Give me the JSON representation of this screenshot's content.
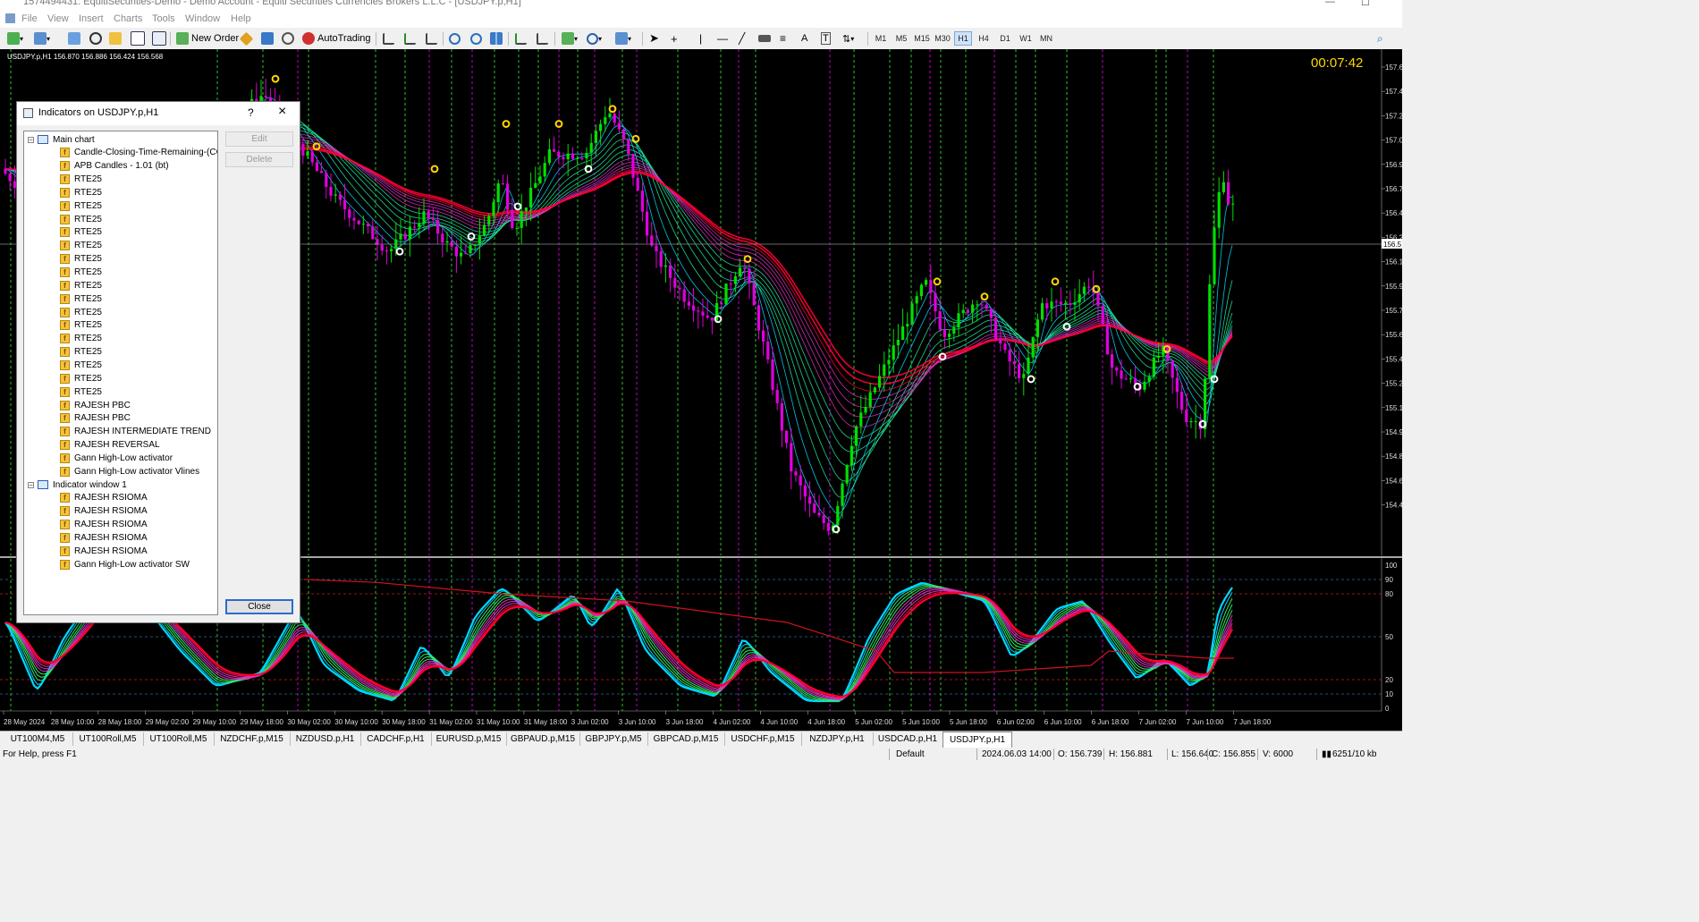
{
  "window": {
    "title": "1574494431: EquitiSecurities-Demo - Demo Account - Equiti Securities Currencies Brokers L.L.C - [USDJPY.p,H1]"
  },
  "menu": [
    "File",
    "View",
    "Insert",
    "Charts",
    "Tools",
    "Window",
    "Help"
  ],
  "toolbar": {
    "new_order": "New Order",
    "autotrading": "AutoTrading",
    "timeframes": [
      "M1",
      "M5",
      "M15",
      "M30",
      "H1",
      "H4",
      "D1",
      "W1",
      "MN"
    ],
    "active_timeframe": "H1"
  },
  "chart": {
    "symbol_info": "USDJPY.p,H1  156.870 156.886 156.424 156.568",
    "timer": "00:07:42",
    "current_price": "156.5",
    "price_labels": [
      "157.6",
      "157.4",
      "157.2",
      "157.0",
      "156.9",
      "156.7",
      "156.4",
      "156.2",
      "156.1",
      "155.9",
      "155.7",
      "155.6",
      "155.4",
      "155.2",
      "155.1",
      "154.9",
      "154.8",
      "154.6",
      "154.4"
    ],
    "osc_labels": [
      "100",
      "90",
      "80",
      "50",
      "20",
      "10",
      "0"
    ],
    "time_labels": [
      "28 May 2024",
      "28 May 10:00",
      "28 May 18:00",
      "29 May 02:00",
      "29 May 10:00",
      "29 May 18:00",
      "30 May 02:00",
      "30 May 10:00",
      "30 May 18:00",
      "31 May 02:00",
      "31 May 10:00",
      "31 May 18:00",
      "3 Jun 02:00",
      "3 Jun 10:00",
      "3 Jun 18:00",
      "4 Jun 02:00",
      "4 Jun 10:00",
      "4 Jun 18:00",
      "5 Jun 02:00",
      "5 Jun 10:00",
      "5 Jun 18:00",
      "6 Jun 02:00",
      "6 Jun 10:00",
      "6 Jun 18:00",
      "7 Jun 02:00",
      "7 Jun 10:00",
      "7 Jun 18:00"
    ],
    "colors": {
      "bg": "#000000",
      "bull": "#00e000",
      "bear": "#e000e0",
      "fast_band": "#00d8ff",
      "slow_band": "#ff0033",
      "vline_green": "#2ec02e",
      "vline_magenta": "#c000c0",
      "timer": "#ffd700"
    }
  },
  "dialog": {
    "title": "Indicators on USDJPY.p,H1",
    "help": "?",
    "groups": [
      {
        "label": "Main chart",
        "items": [
          "Candle-Closing-Time-Remaining-(CCTR)",
          "APB Candles - 1.01 (bt)",
          "RTE25",
          "RTE25",
          "RTE25",
          "RTE25",
          "RTE25",
          "RTE25",
          "RTE25",
          "RTE25",
          "RTE25",
          "RTE25",
          "RTE25",
          "RTE25",
          "RTE25",
          "RTE25",
          "RTE25",
          "RTE25",
          "RTE25",
          "RAJESH PBC",
          "RAJESH PBC",
          "RAJESH INTERMEDIATE TREND",
          "RAJESH REVERSAL",
          "Gann High-Low activator",
          "Gann High-Low activator Vlines"
        ]
      },
      {
        "label": "Indicator window 1",
        "items": [
          "RAJESH RSIOMA",
          "RAJESH RSIOMA",
          "RAJESH RSIOMA",
          "RAJESH RSIOMA",
          "RAJESH RSIOMA",
          "Gann High-Low activator SW"
        ]
      }
    ],
    "edit": "Edit",
    "delete": "Delete",
    "close": "Close"
  },
  "tabs": [
    "UT100M4,M5",
    "UT100Roll,M5",
    "UT100Roll,M5",
    "NZDCHF.p,M15",
    "NZDUSD.p,H1",
    "CADCHF.p,H1",
    "EURUSD.p,M15",
    "GBPAUD.p,M15",
    "GBPJPY.p,M5",
    "GBPCAD.p,M15",
    "USDCHF.p,M15",
    "NZDJPY.p,H1",
    "USDCAD.p,H1",
    "USDJPY.p,H1"
  ],
  "active_tab": "USDJPY.p,H1",
  "status": {
    "help": "For Help, press F1",
    "profile": "Default",
    "time": "2024.06.03 14:00",
    "open": "O: 156.739",
    "high": "H: 156.881",
    "low": "L: 156.640",
    "close": "C: 156.855",
    "volume": "V: 6000",
    "traffic": "6251/10 kb"
  }
}
